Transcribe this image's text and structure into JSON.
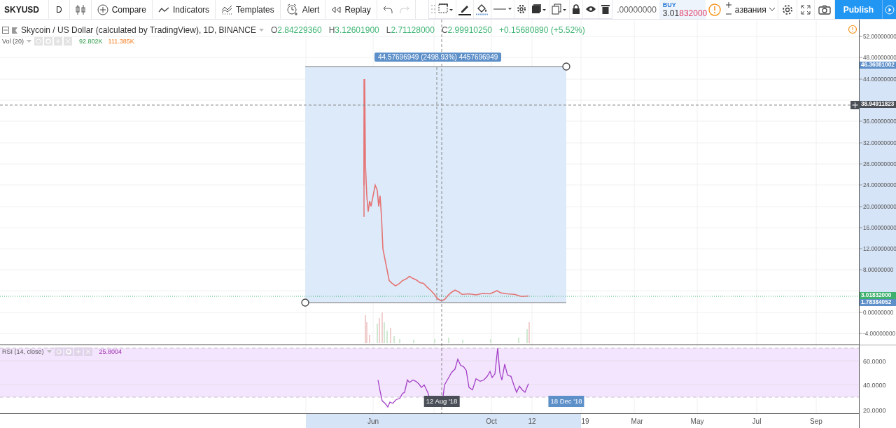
{
  "toolbar": {
    "symbol": "SKYUSD",
    "interval": "D",
    "buttons": [
      {
        "kind": "compare",
        "label": "Compare"
      },
      {
        "kind": "indicators",
        "label": "Indicators"
      },
      {
        "kind": "templates",
        "label": "Templates"
      },
      {
        "kind": "alert",
        "label": "Alert"
      },
      {
        "kind": "replay",
        "label": "Replay"
      }
    ]
  },
  "order_panel": {
    "sell_price": ".00000000",
    "buy_label": "BUY",
    "buy_price_head": "3.01",
    "buy_price_tail": "832000"
  },
  "layout_name": "азвания",
  "publish": "Publish",
  "legend": {
    "title": "Skycoin / US Dollar (calculated by TradingView), 1D, BINANCE",
    "ohlc": [
      {
        "key": "O",
        "value": "2.84229360"
      },
      {
        "key": "H",
        "value": "3.12601900"
      },
      {
        "key": "L",
        "value": "2.71128000"
      },
      {
        "key": "C",
        "value": "2.99910250"
      }
    ],
    "change": "+0.15680890 (+5.52%)",
    "volume": {
      "name": "Vol (20)",
      "value": "92.802K",
      "average": "111.385K"
    },
    "rsi": {
      "name": "RSI (14, close)",
      "value": "25.8004"
    }
  },
  "measure_label": "44.57696949 (2498.93%) 4457696949",
  "price_axis": {
    "labels": [
      "52.00000000",
      "48.00000000",
      "44.00000000",
      "36.00000000",
      "32.00000000",
      "28.00000000",
      "24.00000000",
      "20.00000000",
      "16.00000000",
      "12.00000000",
      "8.00000000",
      "0.00000000",
      "-4.00000000"
    ],
    "badges": [
      {
        "kind": "measure",
        "text": "46.36081002"
      },
      {
        "kind": "crosshair",
        "text": "38.94911823"
      },
      {
        "kind": "last",
        "text": "3.01832000"
      },
      {
        "kind": "measure",
        "text": "1.78384052"
      }
    ]
  },
  "rsi_axis": {
    "labels": [
      "60.0000",
      "40.0000",
      "20.0000"
    ]
  },
  "time_axis": {
    "labels": [
      {
        "kind": "tick",
        "text": "Jun"
      },
      {
        "kind": "crosshair",
        "text": "12 Aug '18"
      },
      {
        "kind": "tick",
        "text": "Oct"
      },
      {
        "kind": "tick",
        "text": "12"
      },
      {
        "kind": "measure",
        "text": "18 Dec '18"
      },
      {
        "kind": "tick",
        "text": "19"
      },
      {
        "kind": "tick",
        "text": "Mar"
      },
      {
        "kind": "tick",
        "text": "May"
      },
      {
        "kind": "tick",
        "text": "Jul"
      },
      {
        "kind": "tick",
        "text": "Sep"
      }
    ]
  }
}
